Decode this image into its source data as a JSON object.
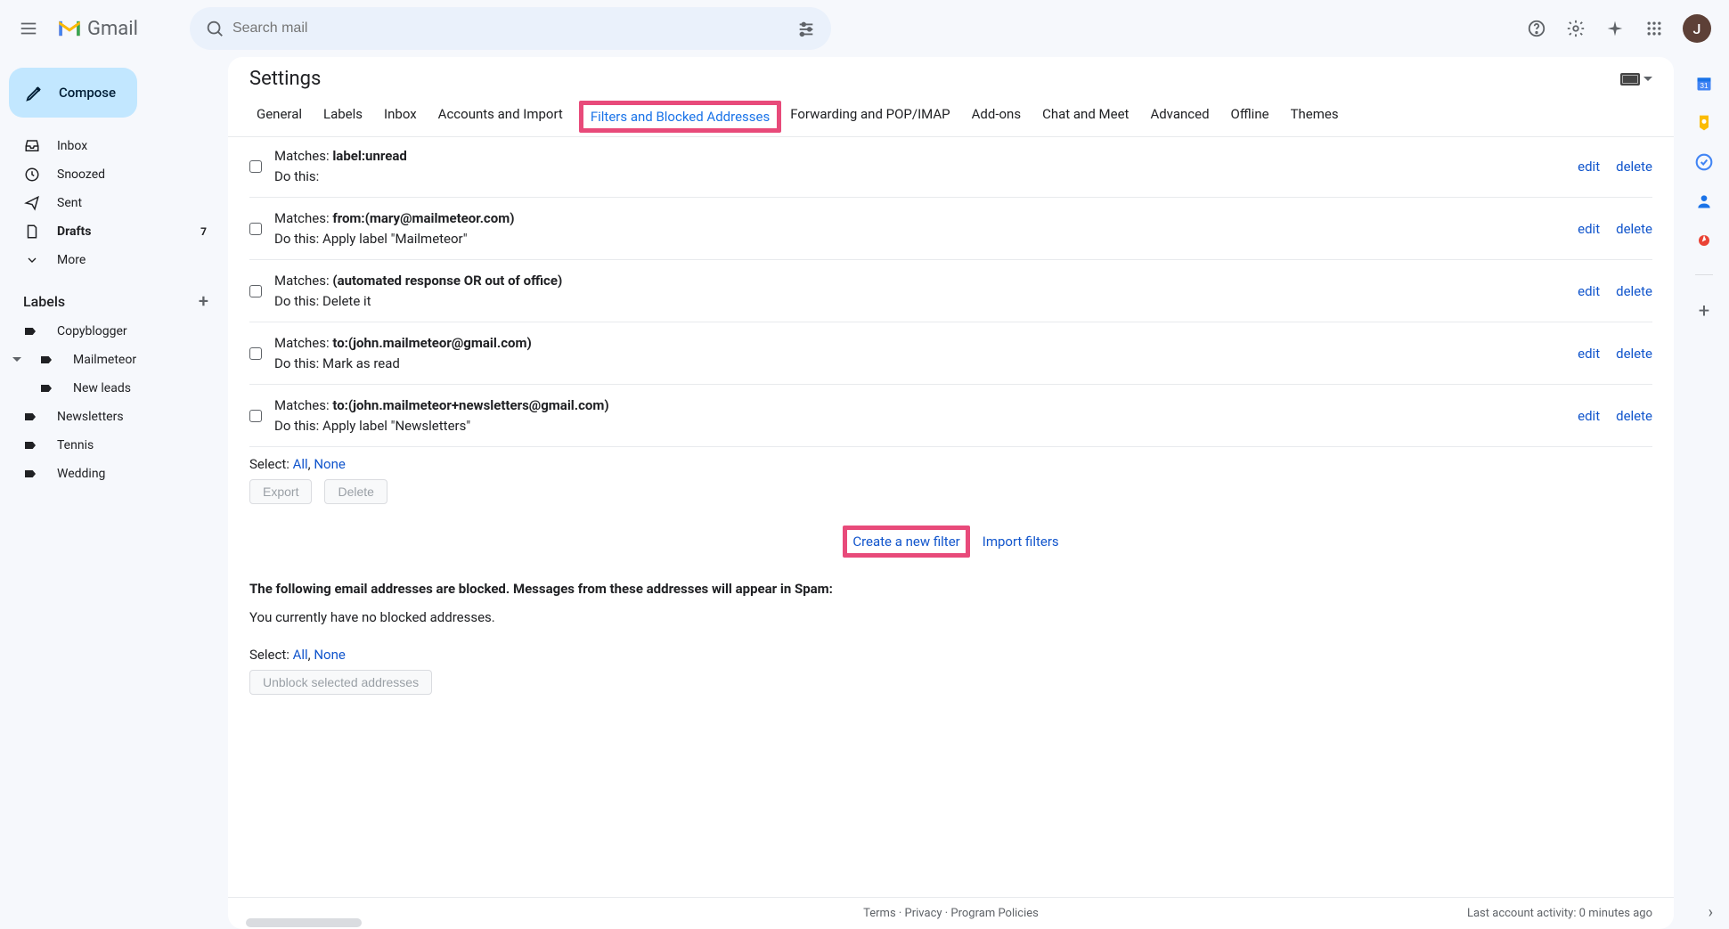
{
  "header": {
    "app_name": "Gmail",
    "search_placeholder": "Search mail",
    "avatar_initial": "J"
  },
  "compose_label": "Compose",
  "nav": {
    "items": [
      {
        "label": "Inbox",
        "icon": "inbox"
      },
      {
        "label": "Snoozed",
        "icon": "clock"
      },
      {
        "label": "Sent",
        "icon": "send"
      },
      {
        "label": "Drafts",
        "icon": "file",
        "count": "7",
        "bold": true
      },
      {
        "label": "More",
        "icon": "chevron-down"
      }
    ]
  },
  "labels": {
    "header": "Labels",
    "items": [
      {
        "label": "Copyblogger"
      },
      {
        "label": "Mailmeteor",
        "has_children": true
      },
      {
        "label": "New leads",
        "nested": true
      },
      {
        "label": "Newsletters"
      },
      {
        "label": "Tennis"
      },
      {
        "label": "Wedding"
      }
    ]
  },
  "settings": {
    "title": "Settings",
    "tabs": [
      "General",
      "Labels",
      "Inbox",
      "Accounts and Import",
      "Filters and Blocked Addresses",
      "Forwarding and POP/IMAP",
      "Add-ons",
      "Chat and Meet",
      "Advanced",
      "Offline",
      "Themes"
    ],
    "active_tab_index": 4
  },
  "filters": [
    {
      "matches": "label:unread",
      "dothis": ""
    },
    {
      "matches": "from:(mary@mailmeteor.com)",
      "dothis": "Apply label \"Mailmeteor\""
    },
    {
      "matches": "(automated response OR out of office)",
      "dothis": "Delete it"
    },
    {
      "matches": "to:(john.mailmeteor@gmail.com)",
      "dothis": "Mark as read"
    },
    {
      "matches": "to:(john.mailmeteor+newsletters@gmail.com)",
      "dothis": "Apply label \"Newsletters\""
    }
  ],
  "filter_row_labels": {
    "matches": "Matches: ",
    "dothis": "Do this: ",
    "edit": "edit",
    "delete": "delete"
  },
  "select_row": {
    "prefix": "Select: ",
    "all": "All",
    "sep": ", ",
    "none": "None"
  },
  "buttons": {
    "export": "Export",
    "delete": "Delete",
    "unblock": "Unblock selected addresses"
  },
  "center_links": {
    "create": "Create a new filter",
    "import": "Import filters"
  },
  "blocked": {
    "heading": "The following email addresses are blocked. Messages from these addresses will appear in Spam:",
    "empty": "You currently have no blocked addresses."
  },
  "footer": {
    "terms": "Terms",
    "privacy": "Privacy",
    "policies": "Program Policies",
    "dot": " · ",
    "activity": "Last account activity: 0 minutes ago"
  }
}
